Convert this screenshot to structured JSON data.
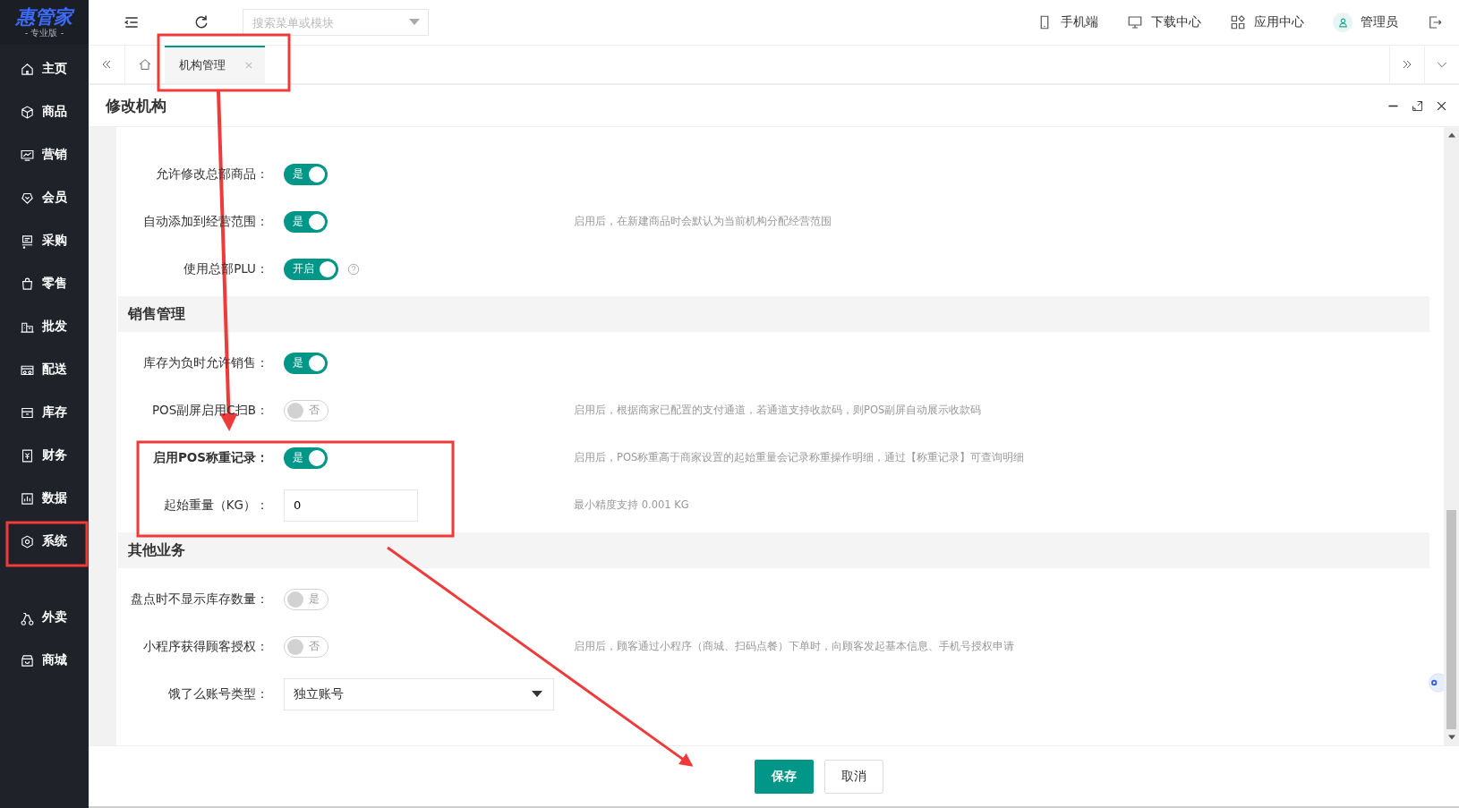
{
  "sidebar": {
    "logo": {
      "title": "惠管家",
      "subtitle": "- 专业版 -"
    },
    "items": [
      {
        "label": "主页",
        "selected": false
      },
      {
        "label": "商品",
        "selected": false
      },
      {
        "label": "营销",
        "selected": false
      },
      {
        "label": "会员",
        "selected": false
      },
      {
        "label": "采购",
        "selected": false
      },
      {
        "label": "零售",
        "selected": false
      },
      {
        "label": "批发",
        "selected": false
      },
      {
        "label": "配送",
        "selected": false
      },
      {
        "label": "库存",
        "selected": false
      },
      {
        "label": "财务",
        "selected": false
      },
      {
        "label": "数据",
        "selected": false
      },
      {
        "label": "系统",
        "selected": false
      }
    ],
    "apps": [
      {
        "label": "外卖",
        "selected": false
      },
      {
        "label": "商城",
        "selected": false
      }
    ]
  },
  "topbar": {
    "search": {
      "placeholder": "搜索菜单或模块"
    },
    "links": [
      {
        "label": "手机端"
      },
      {
        "label": "下载中心"
      },
      {
        "label": "应用中心"
      },
      {
        "label": "管理员"
      }
    ]
  },
  "tabs": [
    {
      "label": "机构管理",
      "selected": true
    }
  ],
  "dialog": {
    "title": "修改机构",
    "sections": [
      {
        "rows": [
          {
            "kind": "switch",
            "label": "允许修改总部商品：",
            "emphasized": false,
            "on": true,
            "switch_text": "是"
          },
          {
            "kind": "switch",
            "label": "自动添加到经营范围：",
            "emphasized": false,
            "on": true,
            "switch_text": "是",
            "note": "启用后，在新建商品时会默认为当前机构分配经营范围"
          },
          {
            "kind": "switch",
            "label": "使用总部PLU：",
            "emphasized": false,
            "on": true,
            "switch_text": "开启",
            "help": true
          }
        ]
      },
      {
        "heading": "销售管理",
        "rows": [
          {
            "kind": "switch",
            "label": "库存为负时允许销售：",
            "emphasized": false,
            "on": true,
            "switch_text": "是"
          },
          {
            "kind": "switch",
            "label": "POS副屏启用C扫B：",
            "emphasized": false,
            "on": false,
            "switch_text": "否",
            "note": "启用后，根据商家已配置的支付通道，若通道支持收款码，则POS副屏自动展示收款码"
          },
          {
            "kind": "switch",
            "label": "启用POS称重记录：",
            "emphasized": true,
            "on": true,
            "switch_text": "是",
            "note": "启用后，POS称重高于商家设置的起始重量会记录称重操作明细，通过【称重记录】可查询明细"
          },
          {
            "kind": "input",
            "label": "起始重量（KG）：",
            "emphasized": false,
            "value": "0",
            "note": "最小精度支持 0.001 KG"
          }
        ]
      },
      {
        "heading": "其他业务",
        "rows": [
          {
            "kind": "switch",
            "label": "盘点时不显示库存数量：",
            "emphasized": false,
            "on": false,
            "switch_text": "是"
          },
          {
            "kind": "switch",
            "label": "小程序获得顾客授权：",
            "emphasized": false,
            "on": false,
            "switch_text": "否",
            "note": "启用后，顾客通过小程序（商城、扫码点餐）下单时，向顾客发起基本信息、手机号授权申请"
          },
          {
            "kind": "select",
            "label": "饿了么账号类型：",
            "emphasized": false,
            "value": "独立账号"
          }
        ]
      }
    ],
    "buttons": [
      {
        "label": "保存",
        "kind": "primary"
      },
      {
        "label": "取消",
        "kind": "default"
      }
    ]
  }
}
